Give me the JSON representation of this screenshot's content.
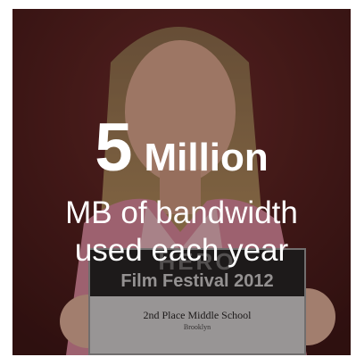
{
  "stat": {
    "number": "5",
    "unit": "Million",
    "line1": "MB of bandwidth",
    "line2": "used each year"
  },
  "photo": {
    "certificate_title": "Film Festival 2012",
    "certificate_line1": "2nd Place Middle School",
    "certificate_line2": "Brooklyn",
    "certificate_logo": "HERO"
  },
  "colors": {
    "background": "#5a1f1e",
    "text": "#ffffff",
    "certificate": "#cfcfcf"
  }
}
